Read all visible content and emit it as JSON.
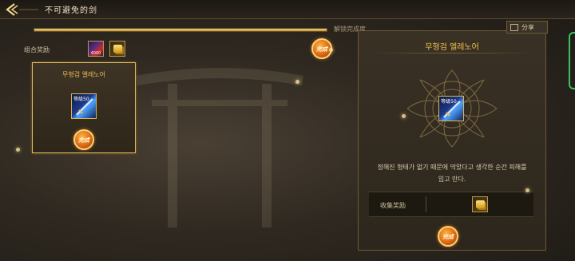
{
  "header": {
    "title": "不可避免的剑"
  },
  "progress": {
    "fill_fraction": 1.0,
    "label": "解锁完成度"
  },
  "rewards": {
    "label": "组合奖励",
    "items": [
      {
        "icon": "sword-item-icon",
        "caption": "4000"
      },
      {
        "icon": "gold-item-icon",
        "caption": ""
      }
    ],
    "stamp_text": "完成"
  },
  "card": {
    "name": "무형검 엘레노어",
    "level": "等级50",
    "stamp_text": "完成"
  },
  "panel": {
    "tab_label": "分享",
    "title": "무형검 엘레노어",
    "item_level": "等级50",
    "description": "정해진 형태가 없기 때문에 막았다고 생각한 순간 피해를 입고 만다.",
    "collect_label": "收集奖励",
    "stamp_text": "完成"
  },
  "colors": {
    "gold_accent": "#f0c050",
    "stamp_orange": "#e06a10",
    "card_border": "#e2bd62"
  }
}
